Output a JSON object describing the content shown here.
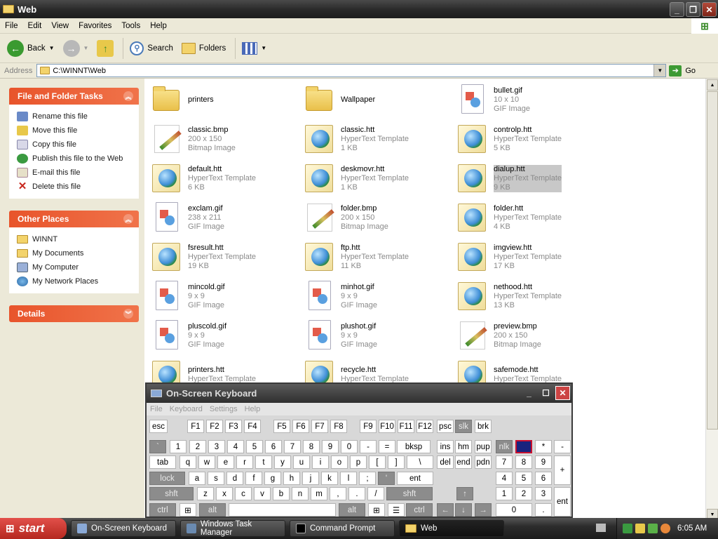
{
  "window": {
    "title": "Web"
  },
  "menu": [
    "File",
    "Edit",
    "View",
    "Favorites",
    "Tools",
    "Help"
  ],
  "toolbar": {
    "back_label": "Back",
    "search_label": "Search",
    "folders_label": "Folders"
  },
  "address": {
    "label": "Address",
    "value": "C:\\WINNT\\Web",
    "go_label": "Go"
  },
  "tasks_panel": {
    "title": "File and Folder Tasks",
    "items": [
      "Rename this file",
      "Move this file",
      "Copy this file",
      "Publish this file to the Web",
      "E-mail this file",
      "Delete this file"
    ]
  },
  "places_panel": {
    "title": "Other Places",
    "items": [
      "WINNT",
      "My Documents",
      "My Computer",
      "My Network Places"
    ]
  },
  "details_panel": {
    "title": "Details"
  },
  "files": [
    {
      "name": "printers",
      "type": "",
      "size": "",
      "icon": "folder"
    },
    {
      "name": "Wallpaper",
      "type": "",
      "size": "",
      "icon": "folder"
    },
    {
      "name": "bullet.gif",
      "type": "GIF Image",
      "size": "10 x 10",
      "icon": "gif"
    },
    {
      "name": "classic.bmp",
      "type": "Bitmap Image",
      "size": "200 x 150",
      "icon": "bmp"
    },
    {
      "name": "classic.htt",
      "type": "HyperText Template",
      "size": "1 KB",
      "icon": "htt"
    },
    {
      "name": "controlp.htt",
      "type": "HyperText Template",
      "size": "5 KB",
      "icon": "htt"
    },
    {
      "name": "default.htt",
      "type": "HyperText Template",
      "size": "6 KB",
      "icon": "htt"
    },
    {
      "name": "deskmovr.htt",
      "type": "HyperText Template",
      "size": "1 KB",
      "icon": "htt"
    },
    {
      "name": "dialup.htt",
      "type": "HyperText Template",
      "size": "9 KB",
      "icon": "htt",
      "selected": true
    },
    {
      "name": "exclam.gif",
      "type": "GIF Image",
      "size": "238 x 211",
      "icon": "gif"
    },
    {
      "name": "folder.bmp",
      "type": "Bitmap Image",
      "size": "200 x 150",
      "icon": "bmp"
    },
    {
      "name": "folder.htt",
      "type": "HyperText Template",
      "size": "4 KB",
      "icon": "htt"
    },
    {
      "name": "fsresult.htt",
      "type": "HyperText Template",
      "size": "19 KB",
      "icon": "htt"
    },
    {
      "name": "ftp.htt",
      "type": "HyperText Template",
      "size": "11 KB",
      "icon": "htt"
    },
    {
      "name": "imgview.htt",
      "type": "HyperText Template",
      "size": "17 KB",
      "icon": "htt"
    },
    {
      "name": "mincold.gif",
      "type": "GIF Image",
      "size": "9 x 9",
      "icon": "gif"
    },
    {
      "name": "minhot.gif",
      "type": "GIF Image",
      "size": "9 x 9",
      "icon": "gif"
    },
    {
      "name": "nethood.htt",
      "type": "HyperText Template",
      "size": "13 KB",
      "icon": "htt"
    },
    {
      "name": "pluscold.gif",
      "type": "GIF Image",
      "size": "9 x 9",
      "icon": "gif"
    },
    {
      "name": "plushot.gif",
      "type": "GIF Image",
      "size": "9 x 9",
      "icon": "gif"
    },
    {
      "name": "preview.bmp",
      "type": "Bitmap Image",
      "size": "200 x 150",
      "icon": "bmp"
    },
    {
      "name": "printers.htt",
      "type": "HyperText Template",
      "size": "",
      "icon": "htt"
    },
    {
      "name": "recycle.htt",
      "type": "HyperText Template",
      "size": "",
      "icon": "htt"
    },
    {
      "name": "safemode.htt",
      "type": "HyperText Template",
      "size": "",
      "icon": "htt"
    }
  ],
  "osk": {
    "title": "On-Screen Keyboard",
    "menu": [
      "File",
      "Keyboard",
      "Settings",
      "Help"
    ],
    "row1": [
      "esc",
      "F1",
      "F2",
      "F3",
      "F4",
      "F5",
      "F6",
      "F7",
      "F8",
      "F9",
      "F10",
      "F11",
      "F12",
      "psc",
      "slk",
      "brk"
    ],
    "row2": [
      "`",
      "1",
      "2",
      "3",
      "4",
      "5",
      "6",
      "7",
      "8",
      "9",
      "0",
      "-",
      "=",
      "bksp",
      "ins",
      "hm",
      "pup",
      "nlk",
      "",
      "*",
      "-"
    ],
    "row3": [
      "tab",
      "q",
      "w",
      "e",
      "r",
      "t",
      "y",
      "u",
      "i",
      "o",
      "p",
      "[",
      "]",
      "\\",
      "del",
      "end",
      "pdn",
      "7",
      "8",
      "9",
      "+"
    ],
    "row4": [
      "lock",
      "a",
      "s",
      "d",
      "f",
      "g",
      "h",
      "j",
      "k",
      "l",
      ";",
      "'",
      "ent",
      "4",
      "5",
      "6"
    ],
    "row5": [
      "shft",
      "z",
      "x",
      "c",
      "v",
      "b",
      "n",
      "m",
      ",",
      ".",
      "/",
      "shft",
      "↑",
      "1",
      "2",
      "3",
      "ent"
    ],
    "row6": [
      "ctrl",
      "alt",
      "alt",
      "ctrl",
      "←",
      "↓",
      "→",
      "0",
      "."
    ]
  },
  "taskbar": {
    "start_label": "start",
    "tasks": [
      "On-Screen Keyboard",
      "Windows Task Manager",
      "Command Prompt",
      "Web"
    ],
    "clock": "6:05 AM"
  }
}
